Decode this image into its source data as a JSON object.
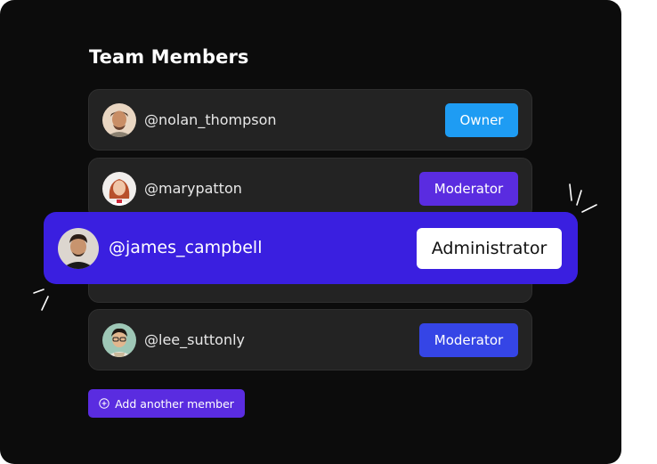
{
  "section": {
    "title": "Team Members"
  },
  "members": [
    {
      "handle": "@nolan_thompson",
      "role": "Owner",
      "role_color": "#1e9cf3",
      "avatar": "avatar-icon"
    },
    {
      "handle": "@marypatton",
      "role": "Moderator",
      "role_color": "#5a2ce0",
      "avatar": "avatar-icon"
    },
    {
      "handle": "@james_campbell",
      "role": "Administrator",
      "role_color": "#ffffff",
      "avatar": "avatar-icon",
      "highlighted": true
    },
    {
      "handle": "@lee_suttonly",
      "role": "Moderator",
      "role_color": "#3545e6",
      "avatar": "avatar-icon"
    }
  ],
  "actions": {
    "add_member_label": "Add another member"
  },
  "colors": {
    "card_bg": "#0c0c0c",
    "row_bg": "#232323",
    "highlight_bg": "#3a1fe0",
    "owner_badge": "#1e9cf3",
    "moderator_badge_purple": "#5a2ce0",
    "moderator_badge_blue": "#3545e6"
  }
}
